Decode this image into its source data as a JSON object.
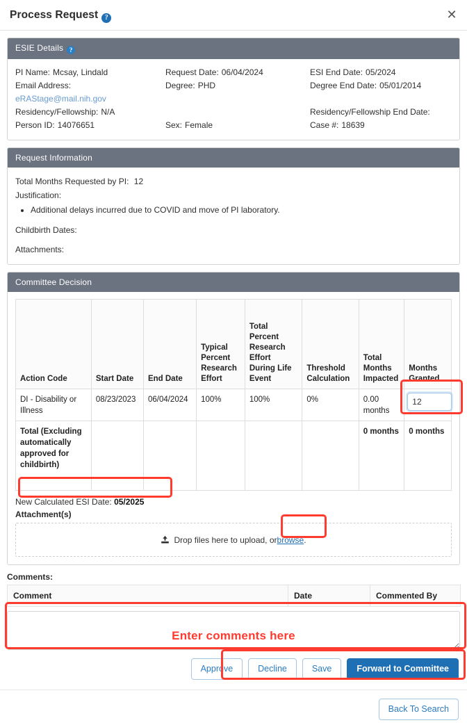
{
  "modal": {
    "title": "Process Request",
    "help_icon": "help-circle-icon",
    "close_icon": "close-icon"
  },
  "esie": {
    "header": "ESIE Details",
    "help_icon": "help-circle-icon",
    "fields": {
      "pi_name_label": "PI Name:",
      "pi_name_value": "Mcsay, Lindald",
      "email_label": "Email Address:",
      "email_value": "eRAStage@mail.nih.gov",
      "residency_label": "Residency/Fellowship:",
      "residency_value": "N/A",
      "person_id_label": "Person ID:",
      "person_id_value": "14076651",
      "request_date_label": "Request Date:",
      "request_date_value": "06/04/2024",
      "degree_label": "Degree:",
      "degree_value": "PHD",
      "sex_label": "Sex:",
      "sex_value": "Female",
      "esi_end_label": "ESI End Date:",
      "esi_end_value": "05/2024",
      "degree_end_label": "Degree End Date:",
      "degree_end_value": "05/01/2014",
      "residency_end_label": "Residency/Fellowship End Date:",
      "residency_end_value": "",
      "case_label": "Case #:",
      "case_value": "18639"
    }
  },
  "request_info": {
    "header": "Request Information",
    "total_months_label": "Total Months Requested by PI:",
    "total_months_value": "12",
    "justification_label": "Justification:",
    "justification_items": [
      "Additional delays incurred due to COVID and move of PI laboratory."
    ],
    "childbirth_label": "Childbirth Dates:",
    "attachments_label": "Attachments:"
  },
  "committee": {
    "header": "Committee Decision",
    "columns": [
      "Action Code",
      "Start Date",
      "End Date",
      "Typical Percent Research Effort",
      "Total Percent Research Effort During Life Event",
      "Threshold Calculation",
      "Total Months Impacted",
      "Months Granted"
    ],
    "rows": [
      {
        "action_code": "DI - Disability or Illness",
        "start_date": "08/23/2023",
        "end_date": "06/04/2024",
        "typical_percent": "100%",
        "total_percent": "100%",
        "threshold": "0%",
        "months_impacted": "0.00 months",
        "months_granted_input": "12"
      }
    ],
    "total_row": {
      "label": "Total (Excluding automatically approved for childbirth)",
      "months_impacted": "0 months",
      "months_granted": "0 months"
    },
    "new_esi_label": "New Calculated ESI Date:",
    "new_esi_value": "05/2025",
    "attachment_label": "Attachment(s)",
    "dropzone_text_before": "Drop files here to upload, or ",
    "dropzone_browse": "browse",
    "dropzone_text_after": ".",
    "upload_icon": "upload-icon"
  },
  "comments": {
    "label": "Comments:",
    "columns": [
      "Comment",
      "Date",
      "Commented By"
    ],
    "rows": [],
    "input_value": "",
    "input_placeholder": "",
    "overlay_text": "Enter comments here"
  },
  "actions": {
    "approve": "Approve",
    "decline": "Decline",
    "save": "Save",
    "forward": "Forward to Committee",
    "back_to_search": "Back To Search"
  },
  "colors": {
    "panel_header": "#6b7280",
    "primary_blue": "#1f6fb4",
    "link_blue": "#6a9bd1",
    "annotation_red": "#ff3b30"
  }
}
